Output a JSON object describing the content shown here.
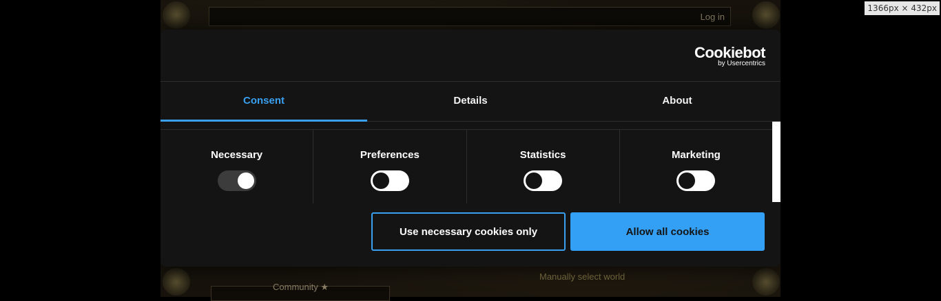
{
  "background": {
    "login_label": "Log in",
    "community_label": "Community ★",
    "manual_world_label": "Manually select world"
  },
  "viewport_badge": "1366px × 432px",
  "dialog": {
    "logo": {
      "main": "Cookiebot",
      "sub": "by Usercentrics"
    },
    "tabs": [
      {
        "label": "Consent",
        "active": true
      },
      {
        "label": "Details",
        "active": false
      },
      {
        "label": "About",
        "active": false
      }
    ],
    "categories": [
      {
        "label": "Necessary",
        "enabled": true
      },
      {
        "label": "Preferences",
        "enabled": false
      },
      {
        "label": "Statistics",
        "enabled": false
      },
      {
        "label": "Marketing",
        "enabled": false
      }
    ],
    "buttons": {
      "necessary_only": "Use necessary cookies only",
      "allow_all": "Allow all cookies"
    }
  },
  "colors": {
    "accent": "#3aa0f0",
    "dialog_bg": "#141414"
  }
}
